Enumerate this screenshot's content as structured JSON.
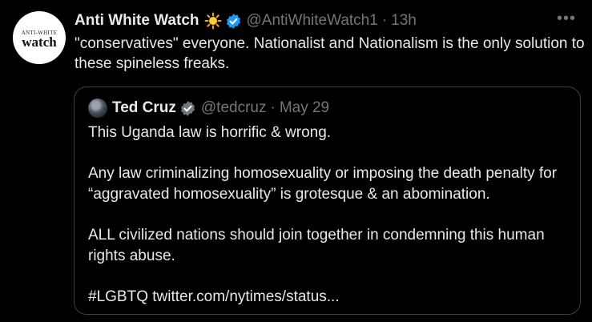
{
  "tweet": {
    "avatar_text_small": "ANTI-WHITE",
    "avatar_text_big": "watch",
    "display_name": "Anti White Watch",
    "handle": "@AntiWhiteWatch1",
    "separator": "·",
    "time": "13h",
    "more_icon": "•••",
    "text": "\"conservatives\" everyone. Nationalist and Nationalism is the only solution to these spineless freaks."
  },
  "quote": {
    "display_name": "Ted Cruz",
    "handle": "@tedcruz",
    "separator": "·",
    "date": "May 29",
    "lines": [
      "This Uganda law is horrific & wrong.",
      "Any law criminalizing homosexuality or imposing the death penalty for “aggravated homosexuality” is grotesque & an abomination.",
      "ALL civilized nations should join together in condemning this human rights abuse.",
      "#LGBTQ twitter.com/nytimes/status..."
    ]
  },
  "colors": {
    "background": "#000000",
    "text": "#e7e9ea",
    "muted": "#71767b",
    "verified": "#1d9bf0",
    "border": "#3a3f43"
  }
}
